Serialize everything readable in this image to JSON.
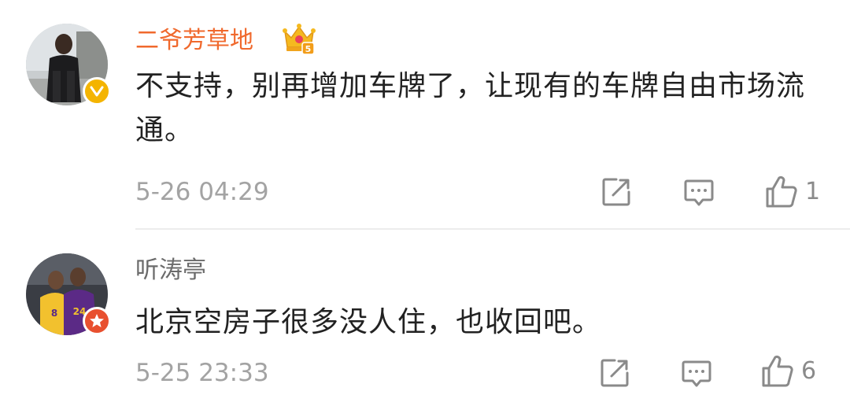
{
  "comments": [
    {
      "username": "二爷芳草地",
      "vip_level": "5",
      "content": "不支持，别再增加车牌了，让现有的车牌自由市场流通。",
      "timestamp": "5-26 04:29",
      "likes": "1",
      "verified_badge": "verified-v-icon",
      "accent": "#f0692d"
    },
    {
      "username": "听涛亭",
      "content": "北京空房子很多没人住，也收回吧。",
      "timestamp": "5-25 23:33",
      "likes": "6",
      "verified_badge": "star-badge-icon",
      "accent": "#e8502f"
    }
  ],
  "icons": {
    "share": "share-edit-icon",
    "reply": "comment-reply-icon",
    "like": "thumbs-up-icon"
  },
  "colors": {
    "username_vip": "#f0692d",
    "username_normal": "#6b6b6b",
    "text": "#222222",
    "meta": "#a3a3a3",
    "verified_gold": "#f4b400",
    "badge_red": "#e8502f"
  }
}
